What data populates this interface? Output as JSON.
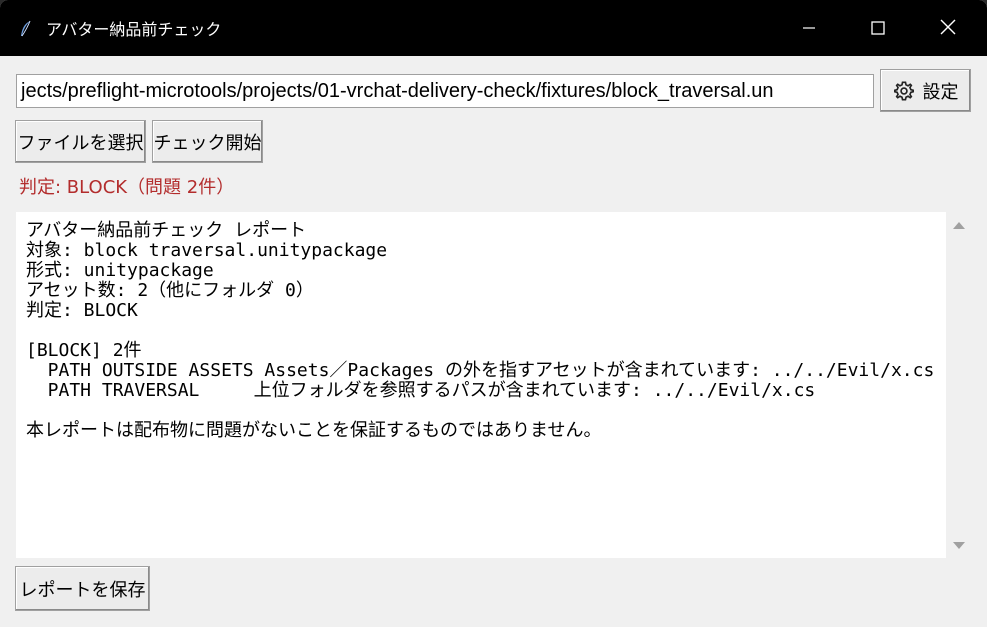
{
  "window": {
    "title": "アバター納品前チェック",
    "icon": "feather-icon",
    "controls": [
      "minimize-icon",
      "maximize-icon",
      "close-icon"
    ]
  },
  "toolbar": {
    "file_path": "jects/preflight-microtools/projects/01-vrchat-delivery-check/fixtures/block_traversal.un",
    "settings_label": "設定",
    "settings_icon": "gear-icon",
    "select_file_label": "ファイルを選択",
    "start_check_label": "チェック開始"
  },
  "verdict": {
    "text": "判定: BLOCK（問題 2件）",
    "color": "#b32d2d"
  },
  "report": {
    "lines": [
      "アバター納品前チェック レポート",
      "対象: block traversal.unitypackage",
      "形式: unitypackage",
      "アセット数: 2（他にフォルダ 0）",
      "判定: BLOCK",
      "",
      "[BLOCK] 2件",
      "  PATH OUTSIDE ASSETS Assets／Packages の外を指すアセットが含まれています: ../../Evil/x.cs",
      "  PATH TRAVERSAL     上位フォルダを参照するパスが含まれています: ../../Evil/x.cs",
      "",
      "本レポートは配布物に問題がないことを保証するものではありません。"
    ]
  },
  "footer": {
    "save_label": "レポートを保存"
  }
}
